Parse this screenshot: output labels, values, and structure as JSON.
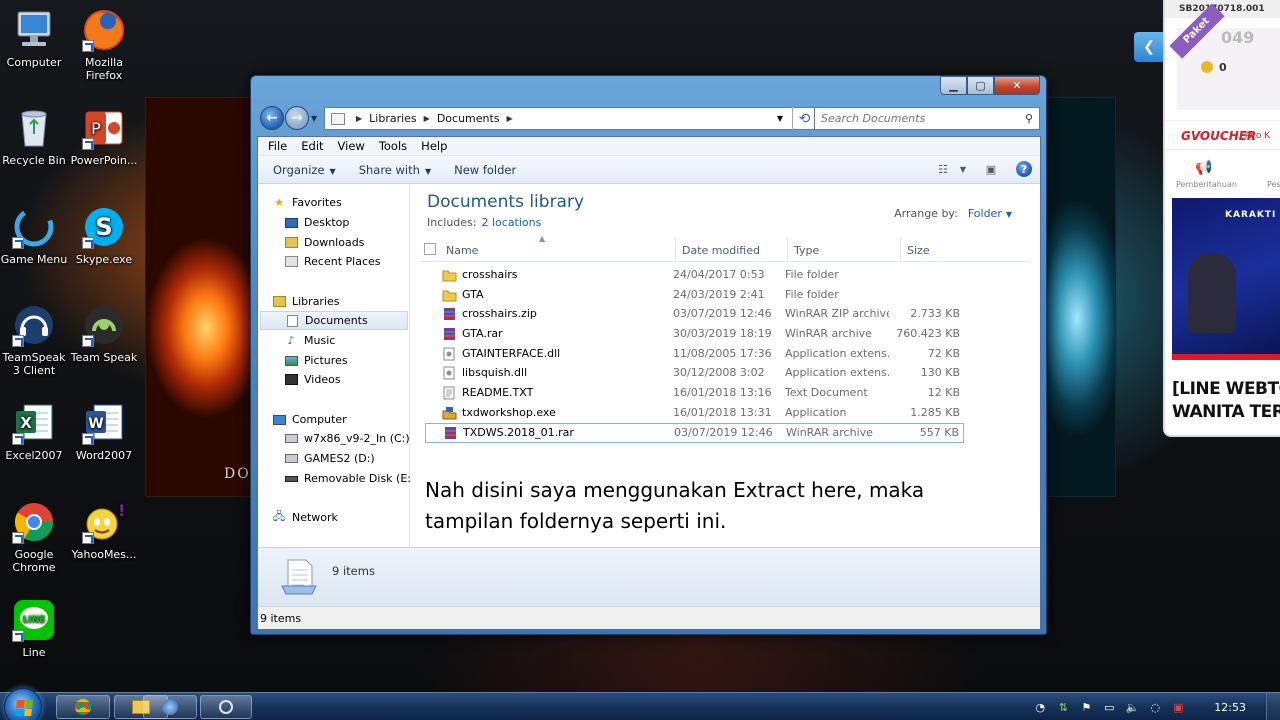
{
  "desktop": {
    "icons": [
      {
        "label": "Computer"
      },
      {
        "label": "Mozilla Firefox"
      },
      {
        "label": "Recycle Bin"
      },
      {
        "label": "PowerPoin..."
      },
      {
        "label": "Game Menu"
      },
      {
        "label": "Skype.exe"
      },
      {
        "label": "TeamSpeak 3 Client"
      },
      {
        "label": "Team Speak"
      },
      {
        "label": "Excel2007"
      },
      {
        "label": "Word2007"
      },
      {
        "label": "Google Chrome"
      },
      {
        "label": "YahooMes..."
      },
      {
        "label": "Line"
      }
    ],
    "wallpaper_text": "DO"
  },
  "window": {
    "breadcrumb": [
      "Libraries",
      "Documents"
    ],
    "search_placeholder": "Search Documents",
    "menu": [
      "File",
      "Edit",
      "View",
      "Tools",
      "Help"
    ],
    "toolbar": {
      "organize": "Organize",
      "share_with": "Share with",
      "new_folder": "New folder"
    },
    "nav": {
      "favorites": "Favorites",
      "desktop": "Desktop",
      "downloads": "Downloads",
      "recent_places": "Recent Places",
      "libraries": "Libraries",
      "documents": "Documents",
      "music": "Music",
      "pictures": "Pictures",
      "videos": "Videos",
      "computer": "Computer",
      "drive_c": "w7x86_v9-2_In (C:)",
      "drive_d": "GAMES2 (D:)",
      "drive_e": "Removable Disk (E:)",
      "network": "Network"
    },
    "library": {
      "title": "Documents library",
      "includes_label": "Includes:",
      "includes_link": "2 locations",
      "arrange_label": "Arrange by:",
      "arrange_value": "Folder"
    },
    "columns": {
      "name": "Name",
      "date": "Date modified",
      "type": "Type",
      "size": "Size"
    },
    "files": [
      {
        "name": "crosshairs",
        "date": "24/04/2017 0:53",
        "type": "File folder",
        "size": "",
        "icon": "folder-icon"
      },
      {
        "name": "GTA",
        "date": "24/03/2019 2:41",
        "type": "File folder",
        "size": "",
        "icon": "folder-icon"
      },
      {
        "name": "crosshairs.zip",
        "date": "03/07/2019 12:46",
        "type": "WinRAR ZIP archive",
        "size": "2.733 KB",
        "icon": "winrar-icon"
      },
      {
        "name": "GTA.rar",
        "date": "30/03/2019 18:19",
        "type": "WinRAR archive",
        "size": "760.423 KB",
        "icon": "winrar-icon"
      },
      {
        "name": "GTAINTERFACE.dll",
        "date": "11/08/2005 17:36",
        "type": "Application extens...",
        "size": "72 KB",
        "icon": "dll-icon"
      },
      {
        "name": "libsquish.dll",
        "date": "30/12/2008 3:02",
        "type": "Application extens...",
        "size": "130 KB",
        "icon": "dll-icon"
      },
      {
        "name": "README.TXT",
        "date": "16/01/2018 13:16",
        "type": "Text Document",
        "size": "12 KB",
        "icon": "text-file-icon"
      },
      {
        "name": "txdworkshop.exe",
        "date": "16/01/2018 13:31",
        "type": "Application",
        "size": "1.285 KB",
        "icon": "exe-icon"
      },
      {
        "name": "TXDWS.2018_01.rar",
        "date": "03/07/2019 12:46",
        "type": "WinRAR archive",
        "size": "557 KB",
        "icon": "winrar-icon"
      }
    ],
    "annotation": "Nah disini saya menggunakan Extract here, maka tampilan foldernya seperti ini.",
    "details_count": "9 items",
    "status": "9 items"
  },
  "widget": {
    "code": "SB20170718.001",
    "badge": "Paket",
    "points": "049",
    "coins": "0",
    "voucher_brand": "VOUCHER",
    "voucher_sub": "Ayo K",
    "notif_label": "Pemberitahuan",
    "notif_label2": "Pes",
    "video_title": "KARAKTI",
    "headline_1": "[LINE WEBTO",
    "headline_2": "WANITA TER"
  },
  "taskbar": {
    "clock": "12:53"
  },
  "colors": {
    "title_blue": "#1e5a8a",
    "link_blue": "#1a5fb4",
    "selection_border": "#8db2e3",
    "taskbar": "#16325a"
  }
}
